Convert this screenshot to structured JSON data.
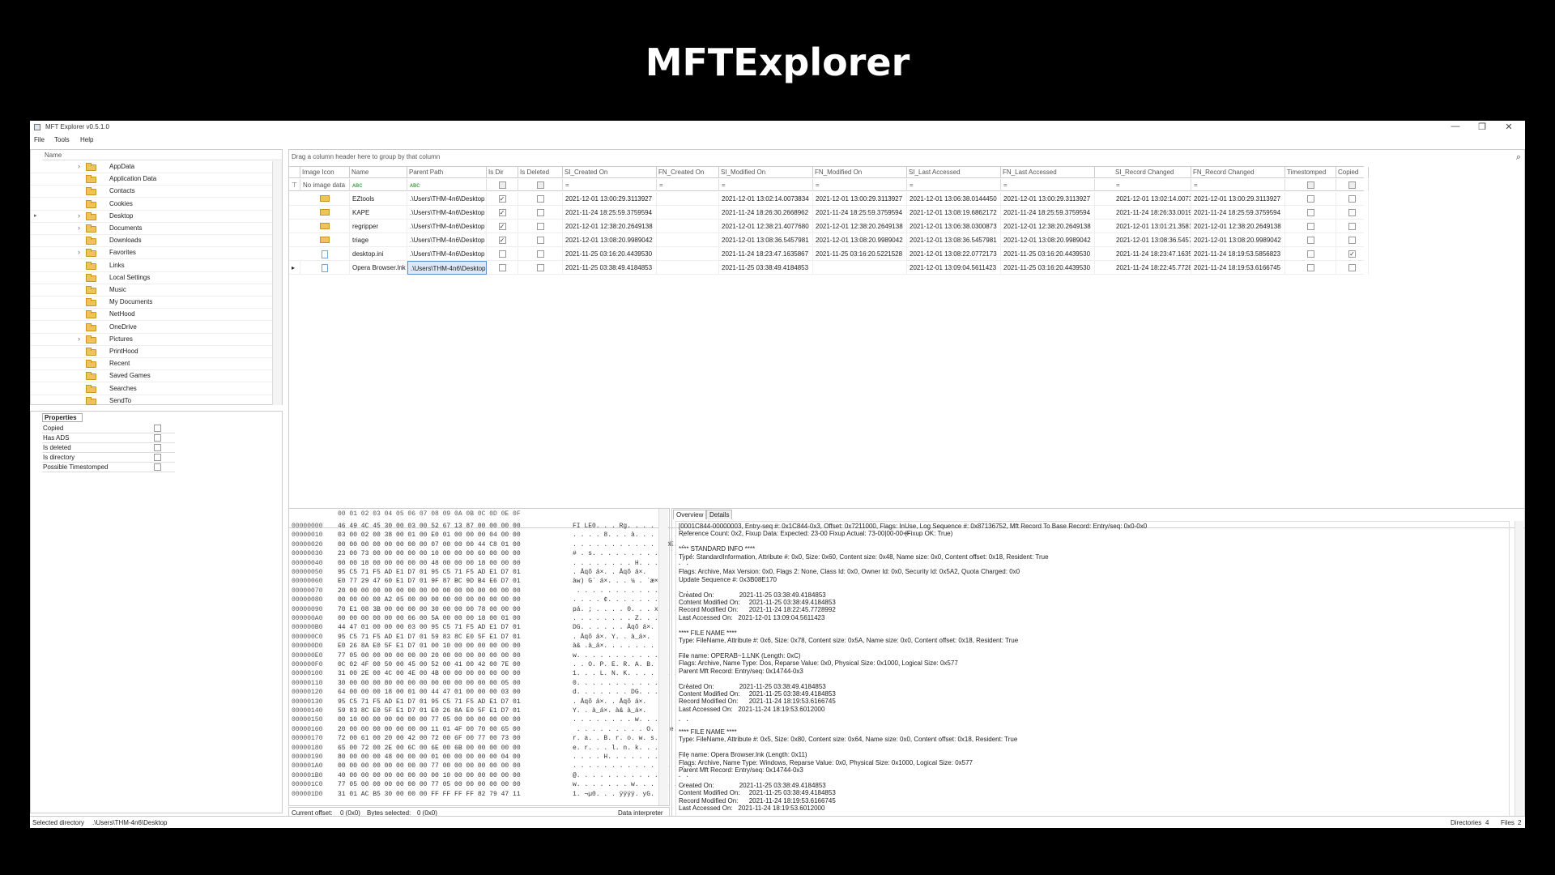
{
  "slide": {
    "title": "MFTExplorer"
  },
  "window": {
    "title": "MFT Explorer v0.5.1.0",
    "minimize": "—",
    "restore": "❐",
    "close": "✕"
  },
  "menu": [
    "File",
    "Tools",
    "Help"
  ],
  "tree": {
    "header": "Name",
    "items": [
      {
        "label": "AppData",
        "expandable": true
      },
      {
        "label": "Application Data",
        "expandable": false
      },
      {
        "label": "Contacts",
        "expandable": false
      },
      {
        "label": "Cookies",
        "expandable": false
      },
      {
        "label": "Desktop",
        "expandable": true,
        "current": true
      },
      {
        "label": "Documents",
        "expandable": true
      },
      {
        "label": "Downloads",
        "expandable": false
      },
      {
        "label": "Favorites",
        "expandable": true
      },
      {
        "label": "Links",
        "expandable": false
      },
      {
        "label": "Local Settings",
        "expandable": false
      },
      {
        "label": "Music",
        "expandable": false
      },
      {
        "label": "My Documents",
        "expandable": false
      },
      {
        "label": "NetHood",
        "expandable": false
      },
      {
        "label": "OneDrive",
        "expandable": false
      },
      {
        "label": "Pictures",
        "expandable": true
      },
      {
        "label": "PrintHood",
        "expandable": false
      },
      {
        "label": "Recent",
        "expandable": false
      },
      {
        "label": "Saved Games",
        "expandable": false
      },
      {
        "label": "Searches",
        "expandable": false
      },
      {
        "label": "SendTo",
        "expandable": false
      }
    ]
  },
  "properties": {
    "header": "Properties",
    "rows": [
      "Copied",
      "Has ADS",
      "Is deleted",
      "Is directory",
      "Possible Timestomped"
    ]
  },
  "grid": {
    "group_hint": "Drag a column header here to group by that column",
    "search_icon": "⌕",
    "columns": [
      "Image Icon",
      "Name",
      "Parent Path",
      "Is Dir",
      "Is Deleted",
      "SI_Created On",
      "FN_Created On",
      "SI_Modified On",
      "FN_Modified On",
      "SI_Last Accessed",
      "FN_Last Accessed",
      "SI_Record Changed",
      "FN_Record Changed",
      "Timestomped",
      "Copied"
    ],
    "filter": {
      "funnel": "⊤",
      "image": "No image data",
      "text_icon": "ᴀʙᴄ",
      "eq": "="
    },
    "rows": [
      {
        "icon": "folder",
        "name": "EZtools",
        "parent": ".\\Users\\THM-4n6\\Desktop",
        "is_dir": true,
        "is_deleted": false,
        "si_created": "2021-12-01 13:00:29.3113927",
        "fn_created": "",
        "si_modified": "2021-12-01 13:02:14.0073834",
        "fn_modified": "2021-12-01 13:00:29.3113927",
        "si_accessed": "2021-12-01 13:06:38.0144450",
        "fn_accessed": "2021-12-01 13:00:29.3113927",
        "si_changed": "2021-12-01 13:02:14.0073834",
        "fn_changed": "2021-12-01 13:00:29.3113927",
        "timestomped": false,
        "copied": false
      },
      {
        "icon": "folder",
        "name": "KAPE",
        "parent": ".\\Users\\THM-4n6\\Desktop",
        "is_dir": true,
        "is_deleted": false,
        "si_created": "2021-11-24 18:25:59.3759594",
        "fn_created": "",
        "si_modified": "2021-11-24 18:26:30.2668962",
        "fn_modified": "2021-11-24 18:25:59.3759594",
        "si_accessed": "2021-12-01 13:08:19.6862172",
        "fn_accessed": "2021-11-24 18:25:59.3759594",
        "si_changed": "2021-11-24 18:26:33.0019324",
        "fn_changed": "2021-11-24 18:25:59.3759594",
        "timestomped": false,
        "copied": false
      },
      {
        "icon": "folder",
        "name": "regripper",
        "parent": ".\\Users\\THM-4n6\\Desktop",
        "is_dir": true,
        "is_deleted": false,
        "si_created": "2021-12-01 12:38:20.2649138",
        "fn_created": "",
        "si_modified": "2021-12-01 12:38:21.4077680",
        "fn_modified": "2021-12-01 12:38:20.2649138",
        "si_accessed": "2021-12-01 13:06:38.0300873",
        "fn_accessed": "2021-12-01 12:38:20.2649138",
        "si_changed": "2021-12-01 13:01:21.3581847",
        "fn_changed": "2021-12-01 12:38:20.2649138",
        "timestomped": false,
        "copied": false
      },
      {
        "icon": "folder",
        "name": "triage",
        "parent": ".\\Users\\THM-4n6\\Desktop",
        "is_dir": true,
        "is_deleted": false,
        "si_created": "2021-12-01 13:08:20.9989042",
        "fn_created": "",
        "si_modified": "2021-12-01 13:08:36.5457981",
        "fn_modified": "2021-12-01 13:08:20.9989042",
        "si_accessed": "2021-12-01 13:08:36.5457981",
        "fn_accessed": "2021-12-01 13:08:20.9989042",
        "si_changed": "2021-12-01 13:08:36.5457981",
        "fn_changed": "2021-12-01 13:08:20.9989042",
        "timestomped": false,
        "copied": false
      },
      {
        "icon": "file",
        "name": "desktop.ini",
        "parent": ".\\Users\\THM-4n6\\Desktop",
        "is_dir": false,
        "is_deleted": false,
        "si_created": "2021-11-25 03:16:20.4439530",
        "fn_created": "",
        "si_modified": "2021-11-24 18:23:47.1635867",
        "fn_modified": "2021-11-25 03:16:20.5221528",
        "si_accessed": "2021-12-01 13:08:22.0772173",
        "fn_accessed": "2021-11-25 03:16:20.4439530",
        "si_changed": "2021-11-24 18:23:47.1635867",
        "fn_changed": "2021-11-24 18:19:53.5856823",
        "timestomped": false,
        "copied": true
      },
      {
        "icon": "file",
        "name": "Opera Browser.lnk",
        "parent": ".\\Users\\THM-4n6\\Desktop",
        "is_dir": false,
        "is_deleted": false,
        "si_created": "2021-11-25 03:38:49.4184853",
        "fn_created": "",
        "si_modified": "2021-11-25 03:38:49.4184853",
        "fn_modified": "",
        "si_accessed": "2021-12-01 13:09:04.5611423",
        "fn_accessed": "2021-11-25 03:16:20.4439530",
        "si_changed": "2021-11-24 18:22:45.7728992",
        "fn_changed": "2021-11-24 18:19:53.6166745",
        "timestomped": false,
        "copied": false,
        "selected": true
      }
    ]
  },
  "hex": {
    "header": "00 01 02 03 04 05 06 07 08 09 0A 0B 0C 0D 0E 0F",
    "lines": [
      {
        "off": "00000000",
        "hex": "46 49 4C 45 30 00 03 00 52 67 13 87 00 00 00 00",
        "ascii": "FI LE0. . . Rg. . . . . ."
      },
      {
        "off": "00000010",
        "hex": "03 00 02 00 38 00 01 00 E0 01 00 00 00 04 00 00",
        "ascii": ". . . . 8. . . à. . . . . . ."
      },
      {
        "off": "00000020",
        "hex": "00 00 00 00 00 00 00 00 07 00 00 00 44 C8 01 00",
        "ascii": ". . . . . . . . . . . . DÈ. ."
      },
      {
        "off": "00000030",
        "hex": "23 00 73 00 00 00 00 00 10 00 00 00 60 00 00 00",
        "ascii": "# . s. . . . . . . . . . `. . ."
      },
      {
        "off": "00000040",
        "hex": "00 00 18 00 00 00 00 00 48 00 00 00 18 00 00 00",
        "ascii": ". . . . . . . . H. . . . . . ."
      },
      {
        "off": "00000050",
        "hex": "95 C5 71 F5 AD E1 D7 01 95 C5 71 F5 AD E1 D7 01",
        "ascii": ". Åqõ á×. . Åqõ á×."
      },
      {
        "off": "00000060",
        "hex": "E0 77 29 47 60 E1 D7 01 9F 87 BC 9D B4 E6 D7 01",
        "ascii": "àw) G` á×. . . ¼ . ´æ×."
      },
      {
        "off": "00000070",
        "hex": "20 00 00 00 00 00 00 00 00 00 00 00 00 00 00 00",
        "ascii": " . . . . . . . . . . . . . . ."
      },
      {
        "off": "00000080",
        "hex": "00 00 00 00 A2 05 00 00 00 00 00 00 00 00 00 00",
        "ascii": ". . . . ¢. . . . . . . . . . ."
      },
      {
        "off": "00000090",
        "hex": "70 E1 08 3B 00 00 00 00 30 00 00 00 78 00 00 00",
        "ascii": "pá. ; . . . . 0. . . x. . ."
      },
      {
        "off": "000000A0",
        "hex": "00 00 00 00 00 00 06 00 5A 00 00 00 18 00 01 00",
        "ascii": ". . . . . . . . Z. . . . . . ."
      },
      {
        "off": "000000B0",
        "hex": "44 47 01 00 00 00 03 00 95 C5 71 F5 AD E1 D7 01",
        "ascii": "DG. . . . . . Åqõ á×."
      },
      {
        "off": "000000C0",
        "hex": "95 C5 71 F5 AD E1 D7 01 59 83 8C E0 5F E1 D7 01",
        "ascii": ". Åqõ á×. Y. . à_á×."
      },
      {
        "off": "000000D0",
        "hex": "E0 26 8A E0 5F E1 D7 01 00 10 00 00 00 00 00 00",
        "ascii": "à& .à_á×. . . . . . . ."
      },
      {
        "off": "000000E0",
        "hex": "77 05 00 00 00 00 00 00 20 00 00 00 00 00 00 00",
        "ascii": "w. . . . . . . . . . . . . . ."
      },
      {
        "off": "000000F0",
        "hex": "0C 02 4F 00 50 00 45 00 52 00 41 00 42 00 7E 00",
        "ascii": ". . O. P. E. R. A. B. ~."
      },
      {
        "off": "00000100",
        "hex": "31 00 2E 00 4C 00 4E 00 4B 00 00 00 00 00 00 00",
        "ascii": "1. . . L. N. K. . . . . . ."
      },
      {
        "off": "00000110",
        "hex": "30 00 00 00 80 00 00 00 00 00 00 00 00 00 05 00",
        "ascii": "0. . . . . . . . . . . . . . ."
      },
      {
        "off": "00000120",
        "hex": "64 00 00 00 18 00 01 00 44 47 01 00 00 00 03 00",
        "ascii": "d. . . . . . . DG. . . . . ."
      },
      {
        "off": "00000130",
        "hex": "95 C5 71 F5 AD E1 D7 01 95 C5 71 F5 AD E1 D7 01",
        "ascii": ". Åqõ á×. . Åqõ á×."
      },
      {
        "off": "00000140",
        "hex": "59 83 8C E0 5F E1 D7 01 E0 26 8A E0 5F E1 D7 01",
        "ascii": "Y. . à_á×. à& à_á×."
      },
      {
        "off": "00000150",
        "hex": "00 10 00 00 00 00 00 00 77 05 00 00 00 00 00 00",
        "ascii": ". . . . . . . . w. . . . . . ."
      },
      {
        "off": "00000160",
        "hex": "20 00 00 00 00 00 00 00 11 01 4F 00 70 00 65 00",
        "ascii": " . . . . . . . . . O. p. e."
      },
      {
        "off": "00000170",
        "hex": "72 00 61 00 20 00 42 00 72 00 6F 00 77 00 73 00",
        "ascii": "r. a. . B. r. o. w. s."
      },
      {
        "off": "00000180",
        "hex": "65 00 72 00 2E 00 6C 00 6E 00 6B 00 00 00 00 00",
        "ascii": "e. r. . . l. n. k. . . . ."
      },
      {
        "off": "00000190",
        "hex": "80 00 00 00 48 00 00 00 01 00 00 00 00 00 04 00",
        "ascii": ". . . . H. . . . . . . . . . ."
      },
      {
        "off": "000001A0",
        "hex": "00 00 00 00 00 00 00 00 77 00 00 00 00 00 00 00",
        "ascii": ". . . . . . . . . . . . . . . ."
      },
      {
        "off": "000001B0",
        "hex": "40 00 00 00 00 00 00 00 00 10 00 00 00 00 00 00",
        "ascii": "@. . . . . . . . . . . . . . ."
      },
      {
        "off": "000001C0",
        "hex": "77 05 00 00 00 00 00 00 77 05 00 00 00 00 00 00",
        "ascii": "w. . . . . . . w. . . . . . ."
      },
      {
        "off": "000001D0",
        "hex": "31 01 AC B5 30 00 00 00 FF FF FF FF 82 79 47 11",
        "ascii": "1. ¬µ0. . . ÿÿÿÿ. yG."
      }
    ],
    "status": {
      "offset_label": "Current offset:",
      "offset_val": "0 (0x0)",
      "bytes_label": "Bytes selected:",
      "bytes_val": "0 (0x0)",
      "interp": "Data interpreter"
    }
  },
  "details": {
    "tabs": [
      "Overview",
      "Details"
    ],
    "text": "[0001C844-00000003, Entry-seq #: 0x1C844-0x3, Offset: 0x7211000, Flags: InUse, Log Sequence #: 0x87136752, Mft Record To Base Record: Entry/seq: 0x0-0x0\nReference Count: 0x2, Fixup Data: Expected: 23-00 Fixup Actual: 73-00|00-00 (Fixup OK: True)\n\n**** STANDARD INFO ****\nType: StandardInformation, Attribute #: 0x0, Size: 0x60, Content size: 0x48, Name size: 0x0, Content offset: 0x18, Resident: True\n\nFlags: Archive, Max Version: 0x0, Flags 2: None, Class Id: 0x0, Owner Id: 0x0, Security Id: 0x5A2, Quota Charged: 0x0\nUpdate Sequence #: 0x3B08E170\n\nCreated On:              2021-11-25 03:38:49.4184853\nContent Modified On:     2021-11-25 03:38:49.4184853\nRecord Modified On:      2021-11-24 18:22:45.7728992\nLast Accessed On:   2021-12-01 13:09:04.5611423\n\n**** FILE NAME ****\nType: FileName, Attribute #: 0x6, Size: 0x78, Content size: 0x5A, Name size: 0x0, Content offset: 0x18, Resident: True\n\nFile name: OPERAB~1.LNK (Length: 0xC)\nFlags: Archive, Name Type: Dos, Reparse Value: 0x0, Physical Size: 0x1000, Logical Size: 0x577\nParent Mft Record: Entry/seq: 0x14744-0x3\n\nCreated On:              2021-11-25 03:38:49.4184853\nContent Modified On:     2021-11-25 03:38:49.4184853\nRecord Modified On:      2021-11-24 18:19:53.6166745\nLast Accessed On:   2021-11-24 18:19:53.6012000\n\n\n**** FILE NAME ****\nType: FileName, Attribute #: 0x5, Size: 0x80, Content size: 0x64, Name size: 0x0, Content offset: 0x18, Resident: True\n\nFile name: Opera Browser.lnk (Length: 0x11)\nFlags: Archive, Name Type: Windows, Reparse Value: 0x0, Physical Size: 0x1000, Logical Size: 0x577\nParent Mft Record: Entry/seq: 0x14744-0x3\n\nCreated On:              2021-11-25 03:38:49.4184853\nContent Modified On:     2021-11-25 03:38:49.4184853\nRecord Modified On:      2021-11-24 18:19:53.6166745\nLast Accessed On:   2021-11-24 18:19:53.6012000"
  },
  "status": {
    "selected_label": "Selected directory",
    "selected_path": ".\\Users\\THM-4n6\\Desktop",
    "dirs_label": "Directories",
    "dirs_val": "4",
    "files_label": "Files",
    "files_val": "2"
  }
}
